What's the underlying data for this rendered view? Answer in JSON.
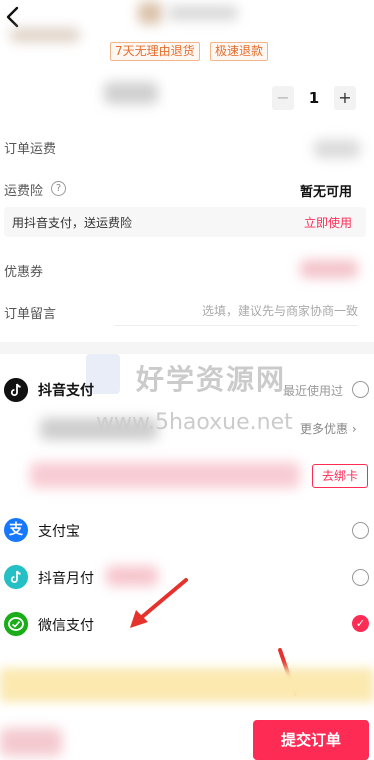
{
  "header": {
    "back_icon": "chevron-left-icon"
  },
  "product": {
    "tags": [
      "7天无理由退货",
      "极速退款"
    ],
    "quantity": "1",
    "minus": "−",
    "plus": "+"
  },
  "order": {
    "freight_label": "订单运费",
    "insurance_label": "运费险",
    "insurance_help": "?",
    "insurance_value": "暂无可用",
    "promo_text": "用抖音支付，送运费险",
    "promo_link": "立即使用",
    "coupon_label": "优惠券",
    "message_label": "订单留言",
    "message_placeholder": "选填，建议先与商家协商一致"
  },
  "payment": {
    "douyin_pay": {
      "label": "抖音支付",
      "recent": "最近使用过",
      "icon": "douyin-icon"
    },
    "more_coupons": "更多优惠",
    "unbind": "去绑卡",
    "alipay": {
      "label": "支付宝",
      "icon": "alipay-icon",
      "glyph": "支"
    },
    "douyin_monthly": {
      "label": "抖音月付",
      "icon": "douyin-monthly-icon"
    },
    "wechat": {
      "label": "微信支付",
      "icon": "wechat-pay-icon",
      "selected_mark": "✓"
    }
  },
  "watermark": {
    "line1": "好学资源网",
    "line2": "www.5haoxue.net"
  },
  "footer": {
    "submit": "提交订单"
  },
  "colors": {
    "accent": "#fe2c55",
    "tag": "#e46d2e",
    "alipay": "#1677ff",
    "wechat": "#1aad19"
  }
}
